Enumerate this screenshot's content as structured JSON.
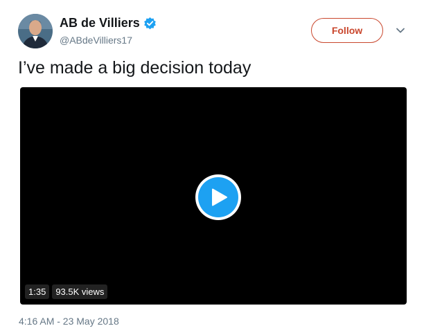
{
  "author": {
    "display_name": "AB de Villiers",
    "handle": "@ABdeVilliers17",
    "verified": true
  },
  "follow_button": {
    "label": "Follow"
  },
  "tweet": {
    "text": "I’ve made a big decision today",
    "timestamp": "4:16 AM - 23 May 2018"
  },
  "video": {
    "duration": "1:35",
    "views": "93.5K views"
  },
  "colors": {
    "accent": "#1da1f2",
    "follow_border": "#c9462c",
    "secondary_text": "#657786",
    "primary_text": "#14171a",
    "video_background": "#000000"
  },
  "icons": {
    "verified": "verified-badge-icon",
    "caret": "chevron-down-icon",
    "play": "play-icon"
  }
}
